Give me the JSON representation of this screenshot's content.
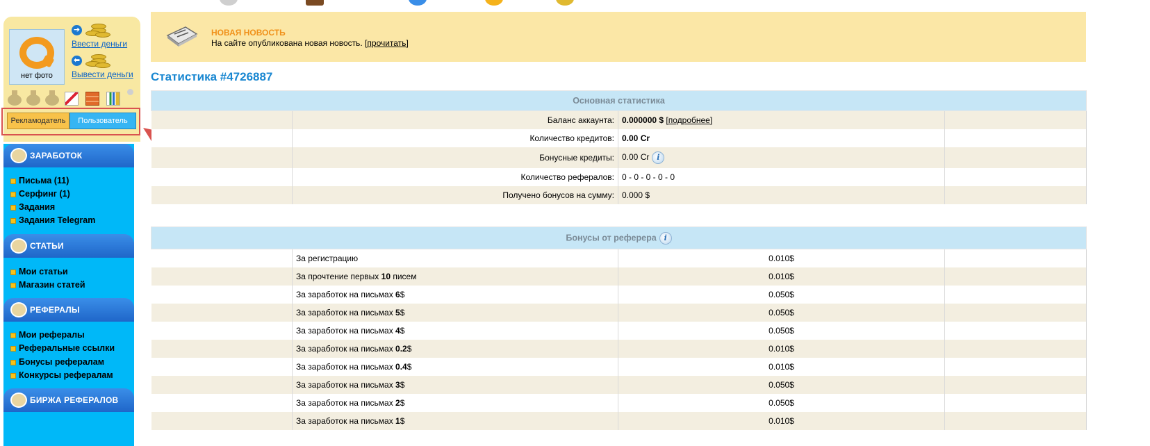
{
  "sidebar": {
    "avatar_label": "нет фото",
    "deposit_link": "Ввести деньги",
    "withdraw_link": "Вывести деньги",
    "role_advertiser": "Рекламодатель",
    "role_user": "Пользователь",
    "sections": [
      {
        "title": "ЗАРАБОТОК",
        "items": [
          "Письма (11)",
          "Серфинг (1)",
          "Задания",
          "Задания Telegram"
        ]
      },
      {
        "title": "СТАТЬИ",
        "items": [
          "Мои статьи",
          "Магазин статей"
        ]
      },
      {
        "title": "РЕФЕРАЛЫ",
        "items": [
          "Мои рефералы",
          "Реферальные ссылки",
          "Бонусы рефералам",
          "Конкурсы рефералам"
        ]
      },
      {
        "title": "БИРЖА РЕФЕРАЛОВ",
        "items": []
      }
    ]
  },
  "news": {
    "title": "НОВАЯ НОВОСТЬ",
    "text": "На сайте опубликована новая новость.",
    "link": "[прочитать]"
  },
  "page_title": "Статистика #4726887",
  "main_stats": {
    "header": "Основная статистика",
    "rows": [
      {
        "label": "Баланс аккаунта:",
        "value": "0.000000 $",
        "extra": "[подробнее]"
      },
      {
        "label": "Количество кредитов:",
        "value": "0.00 Cr"
      },
      {
        "label": "Бонусные кредиты:",
        "value": "0.00 Cr"
      },
      {
        "label": "Количество рефералов:",
        "value": "0 - 0 - 0 - 0 - 0"
      },
      {
        "label": "Получено бонусов на сумму:",
        "value": "0.000 $"
      }
    ]
  },
  "bonus": {
    "header": "Бонусы от реферера",
    "rows": [
      {
        "prefix": "За регистрацию",
        "bold": "",
        "suffix": "",
        "value": "0.010$"
      },
      {
        "prefix": "За прочтение первых ",
        "bold": "10",
        "suffix": " писем",
        "value": "0.010$"
      },
      {
        "prefix": "За заработок на письмах ",
        "bold": "6",
        "suffix": "$",
        "value": "0.050$"
      },
      {
        "prefix": "За заработок на письмах ",
        "bold": "5",
        "suffix": "$",
        "value": "0.050$"
      },
      {
        "prefix": "За заработок на письмах ",
        "bold": "4",
        "suffix": "$",
        "value": "0.050$"
      },
      {
        "prefix": "За заработок на письмах ",
        "bold": "0.2",
        "suffix": "$",
        "value": "0.010$"
      },
      {
        "prefix": "За заработок на письмах ",
        "bold": "0.4",
        "suffix": "$",
        "value": "0.010$"
      },
      {
        "prefix": "За заработок на письмах ",
        "bold": "3",
        "suffix": "$",
        "value": "0.050$"
      },
      {
        "prefix": "За заработок на письмах ",
        "bold": "2",
        "suffix": "$",
        "value": "0.050$"
      },
      {
        "prefix": "За заработок на письмах ",
        "bold": "1",
        "suffix": "$",
        "value": "0.010$"
      }
    ]
  },
  "colors": {
    "accent_blue": "#1987d1",
    "menu_bg": "#00b8f8",
    "news_bg": "#fbe7a6",
    "annotation_red": "#d9534f"
  },
  "icons": [
    "coins-icon",
    "arrow-right-icon",
    "arrow-left-icon",
    "medal-icon",
    "news-fax-icon",
    "info-icon"
  ]
}
